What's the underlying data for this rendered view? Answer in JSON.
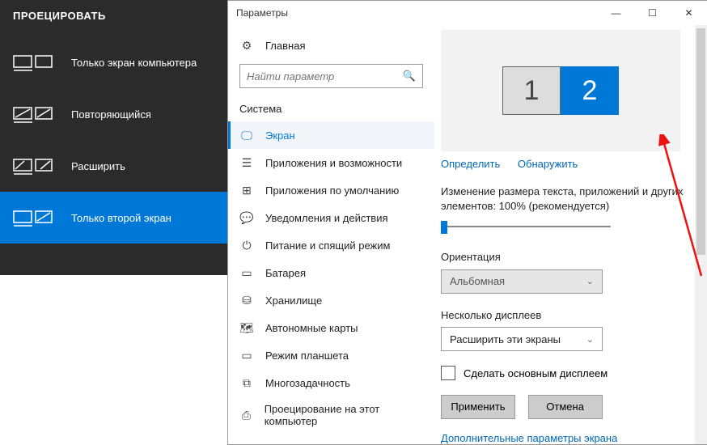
{
  "project": {
    "title": "ПРОЕЦИРОВАТЬ",
    "items": [
      {
        "label": "Только экран компьютера"
      },
      {
        "label": "Повторяющийся"
      },
      {
        "label": "Расширить"
      },
      {
        "label": "Только второй экран"
      }
    ]
  },
  "window": {
    "title": "Параметры"
  },
  "sidebar": {
    "home": "Главная",
    "search_placeholder": "Найти параметр",
    "section": "Система",
    "items": [
      {
        "label": "Экран"
      },
      {
        "label": "Приложения и возможности"
      },
      {
        "label": "Приложения по умолчанию"
      },
      {
        "label": "Уведомления и действия"
      },
      {
        "label": "Питание и спящий режим"
      },
      {
        "label": "Батарея"
      },
      {
        "label": "Хранилище"
      },
      {
        "label": "Автономные карты"
      },
      {
        "label": "Режим планшета"
      },
      {
        "label": "Многозадачность"
      },
      {
        "label": "Проецирование на этот компьютер"
      }
    ]
  },
  "main": {
    "monitors": {
      "m1": "1",
      "m2": "2"
    },
    "identify": "Определить",
    "detect": "Обнаружить",
    "scale_label": "Изменение размера текста, приложений и других элементов: 100% (рекомендуется)",
    "orientation_label": "Ориентация",
    "orientation_value": "Альбомная",
    "multi_label": "Несколько дисплеев",
    "multi_value": "Расширить эти экраны",
    "main_display": "Сделать основным дисплеем",
    "apply": "Применить",
    "cancel": "Отмена",
    "advanced": "Дополнительные параметры экрана"
  }
}
